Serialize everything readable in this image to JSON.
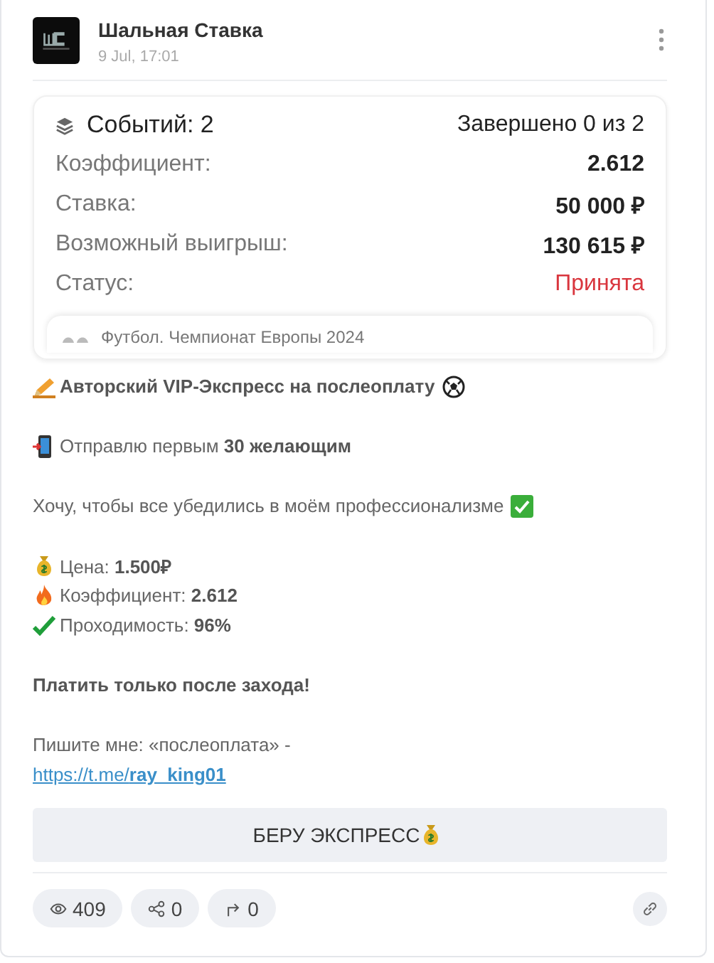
{
  "post": {
    "author": "Шальная Ставка",
    "time": "9 Jul, 17:01"
  },
  "bet": {
    "events": "Событий: 2",
    "progress": "Завершено 0 из 2",
    "rows": [
      {
        "label": "Коэффициент:",
        "value": "2.612",
        "kind": "plain"
      },
      {
        "label": "Ставка:",
        "value": "50 000 ₽",
        "kind": "plain"
      },
      {
        "label": "Возможный выигрыш:",
        "value": "130 615 ₽",
        "kind": "plain"
      },
      {
        "label": "Статус:",
        "value": "Принята",
        "kind": "status"
      }
    ],
    "event_preview": "Футбол. Чемпионат Европы 2024"
  },
  "message": [
    {
      "lines": [
        {
          "kind": "headline",
          "text": "Авторский VIP-Экспресс на послеоплату",
          "bold": true
        }
      ]
    },
    {
      "lines": [
        {
          "kind": "phone",
          "text": "Отправлю первым **30 желающим**",
          "bold": false
        }
      ]
    },
    {
      "lines": [
        {
          "kind": "proof",
          "text": "Хочу, чтобы все убедились в моём профессионализме",
          "bold": false
        }
      ]
    },
    {
      "lines": [
        {
          "kind": "price",
          "text": "Цена: **1.500₽**",
          "bold": false
        },
        {
          "kind": "odds",
          "text": "Коэффициент: **2.612**",
          "bold": false
        },
        {
          "kind": "rate",
          "text": "Проходимость: **96%**",
          "bold": false
        }
      ]
    },
    {
      "lines": [
        {
          "kind": "plain",
          "text": "Платить только после захода!",
          "bold": true
        }
      ]
    },
    {
      "lines": [
        {
          "kind": "plain",
          "text": "Пишите мне: «послеоплата» -",
          "bold": false
        },
        {
          "kind": "link",
          "text": "https://t.me/**ray_king01**"
        }
      ]
    }
  ],
  "button": {
    "label": "БЕРУ ЭКСПРЕСС"
  },
  "footer": {
    "views": "409",
    "shares": "0",
    "forwards": "0"
  }
}
